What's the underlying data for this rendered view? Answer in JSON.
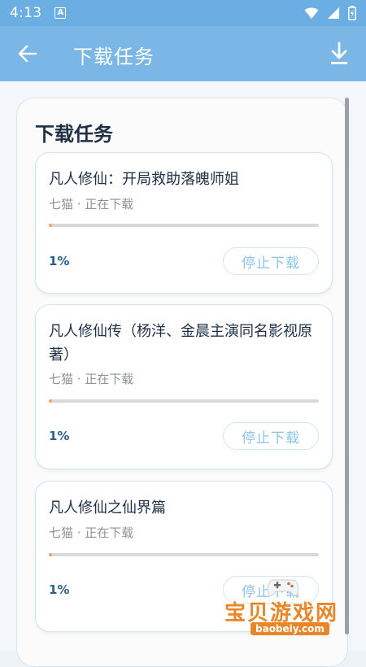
{
  "status_bar": {
    "time": "4:13",
    "indicator": "A"
  },
  "app_bar": {
    "title": "下载任务",
    "back_icon": "arrow-left-icon",
    "download_icon": "download-icon"
  },
  "section": {
    "title": "下载任务"
  },
  "tasks": [
    {
      "title": "凡人修仙：开局救助落魄师姐",
      "status": "七猫 · 正在下载",
      "progress": 0.01,
      "percent": "1%",
      "button": "停止下载"
    },
    {
      "title": "凡人修仙传（杨洋、金晨主演同名影视原著）",
      "status": "七猫 · 正在下载",
      "progress": 0.01,
      "percent": "1%",
      "button": "停止下载"
    },
    {
      "title": "凡人修仙之仙界篇",
      "status": "七猫 · 正在下载",
      "progress": 0.01,
      "percent": "1%",
      "button": "停止下载"
    }
  ],
  "watermark": {
    "text": "宝贝游戏网",
    "url": "baobeiy.com"
  },
  "colors": {
    "status_bar": "#6aaee3",
    "app_bar": "#7ab6e6",
    "progress_fill": "#f3a35b",
    "button_text": "#8cc3e6",
    "percent_text": "#2c5f8a"
  }
}
